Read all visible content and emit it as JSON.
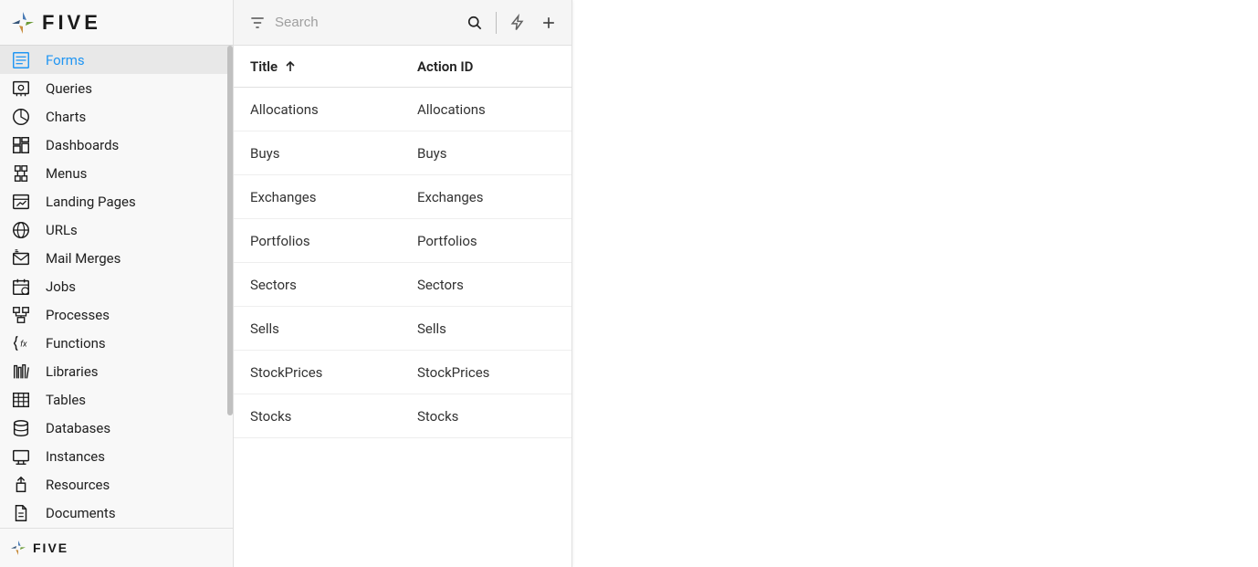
{
  "brand": {
    "name": "FIVE"
  },
  "sidebar": {
    "active_index": 0,
    "items": [
      {
        "label": "Forms",
        "icon": "form-icon"
      },
      {
        "label": "Queries",
        "icon": "query-icon"
      },
      {
        "label": "Charts",
        "icon": "chart-icon"
      },
      {
        "label": "Dashboards",
        "icon": "dashboard-icon"
      },
      {
        "label": "Menus",
        "icon": "menu-icon"
      },
      {
        "label": "Landing Pages",
        "icon": "landing-icon"
      },
      {
        "label": "URLs",
        "icon": "globe-icon"
      },
      {
        "label": "Mail Merges",
        "icon": "mail-icon"
      },
      {
        "label": "Jobs",
        "icon": "calendar-icon"
      },
      {
        "label": "Processes",
        "icon": "process-icon"
      },
      {
        "label": "Functions",
        "icon": "function-icon"
      },
      {
        "label": "Libraries",
        "icon": "library-icon"
      },
      {
        "label": "Tables",
        "icon": "table-icon"
      },
      {
        "label": "Databases",
        "icon": "database-icon"
      },
      {
        "label": "Instances",
        "icon": "instance-icon"
      },
      {
        "label": "Resources",
        "icon": "resource-icon"
      },
      {
        "label": "Documents",
        "icon": "document-icon"
      }
    ]
  },
  "toolbar": {
    "search_placeholder": "Search"
  },
  "table": {
    "columns": {
      "title": "Title",
      "action_id": "Action ID"
    },
    "sort_dir": "asc",
    "rows": [
      {
        "title": "Allocations",
        "action_id": "Allocations"
      },
      {
        "title": "Buys",
        "action_id": "Buys"
      },
      {
        "title": "Exchanges",
        "action_id": "Exchanges"
      },
      {
        "title": "Portfolios",
        "action_id": "Portfolios"
      },
      {
        "title": "Sectors",
        "action_id": "Sectors"
      },
      {
        "title": "Sells",
        "action_id": "Sells"
      },
      {
        "title": "StockPrices",
        "action_id": "StockPrices"
      },
      {
        "title": "Stocks",
        "action_id": "Stocks"
      }
    ]
  }
}
